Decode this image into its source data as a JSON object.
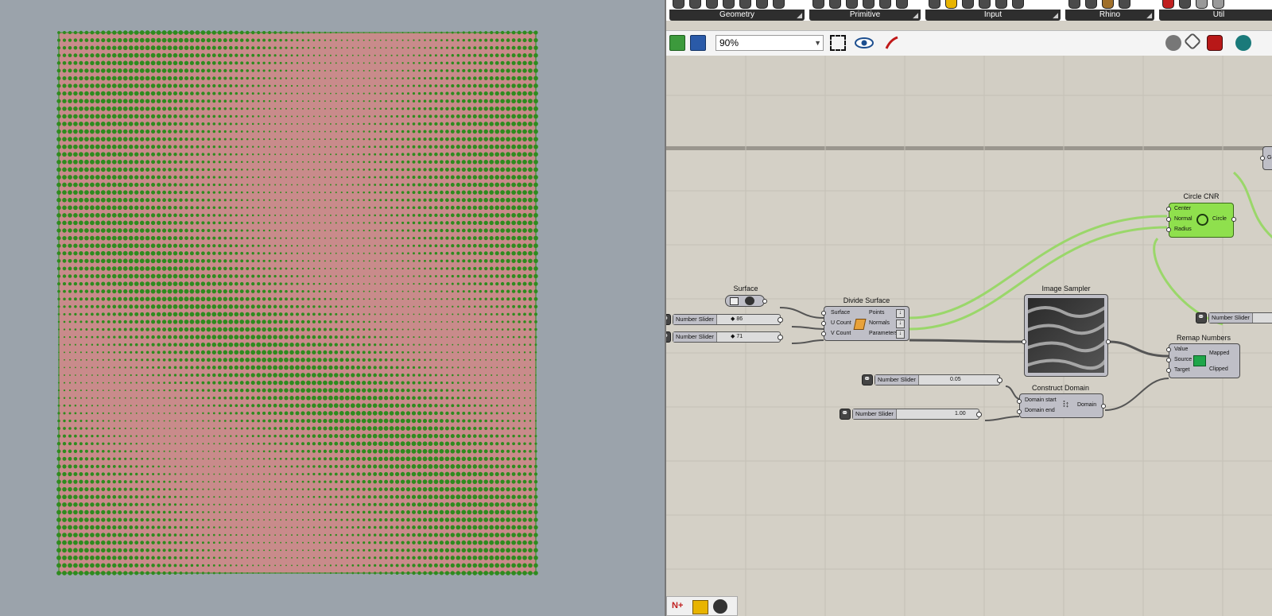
{
  "colors": {
    "viewport_bg": "#9ba3ab",
    "surface_fill": "#c98b8b",
    "points": "#2e8b1e",
    "canvas_bg": "#d4d0c6",
    "wire_green": "#9ad76a",
    "component_gray": "#bfbfc7",
    "component_green": "#8fe04d"
  },
  "ribbon": {
    "groups": [
      {
        "label": "Geometry"
      },
      {
        "label": "Primitive"
      },
      {
        "label": "Input"
      },
      {
        "label": "Rhino"
      },
      {
        "label": "Util"
      }
    ]
  },
  "toolbar": {
    "zoom_value": "90%",
    "icons": [
      "open-file-icon",
      "save-icon",
      "zoom-extents-icon",
      "preview-eye-icon",
      "sketch-pen-icon",
      "shaded-preview-icon",
      "wire-preview-icon",
      "preview-mode-icon"
    ]
  },
  "canvas": {
    "components": {
      "surface": {
        "title": "Surface"
      },
      "divide_surface": {
        "title": "Divide Surface",
        "inputs": [
          "Surface",
          "U Count",
          "V Count"
        ],
        "outputs": [
          "Points",
          "Normals",
          "Parameters"
        ]
      },
      "image_sampler": {
        "title": "Image Sampler"
      },
      "circle_cnr": {
        "title": "Circle CNR",
        "inputs": [
          "Center",
          "Normal",
          "Radius"
        ],
        "outputs": [
          "Circle"
        ]
      },
      "remap_numbers": {
        "title": "Remap Numbers",
        "inputs": [
          "Value",
          "Source",
          "Target"
        ],
        "outputs": [
          "Mapped",
          "Clipped"
        ]
      },
      "construct_domain": {
        "title": "Construct Domain",
        "inputs": [
          "Domain start",
          "Domain end"
        ],
        "outputs": [
          "Domain"
        ]
      },
      "right_edge_component": {
        "pin": "Ge"
      }
    },
    "sliders": [
      {
        "name": "Number Slider",
        "value": "◆ 86"
      },
      {
        "name": "Number Slider",
        "value": "◆ 71"
      },
      {
        "name": "Number Slider",
        "value": "0.05"
      },
      {
        "name": "Number Slider",
        "value": "1.00"
      },
      {
        "name": "Number Slider",
        "value": ""
      }
    ]
  },
  "bottom_bar": {
    "icons": [
      "new-component-icon",
      "group-icon",
      "radial-menu-icon"
    ]
  }
}
